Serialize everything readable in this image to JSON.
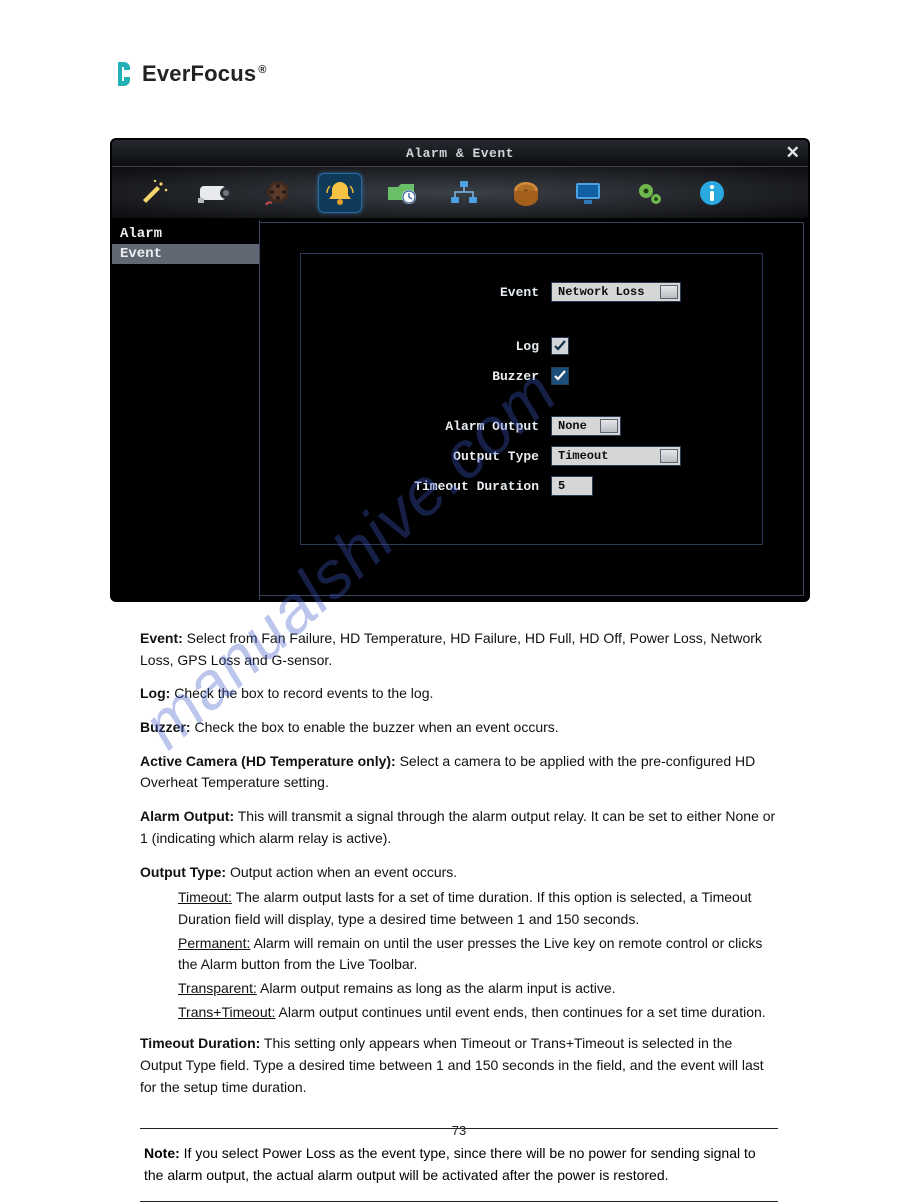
{
  "brand": {
    "ever": "Ever",
    "focus": "Focus",
    "registered": "®"
  },
  "screenshot": {
    "window_title": "Alarm & Event",
    "close_glyph": "✕",
    "toolbar_icons": [
      "wand-icon",
      "camera-icon",
      "reel-icon",
      "bell-icon",
      "folder-clock-icon",
      "network-icon",
      "disk-icon",
      "monitor-icon",
      "gear-icon",
      "info-icon"
    ],
    "toolbar_selected_index": 3,
    "side_items": [
      "Alarm",
      "Event"
    ],
    "side_active_index": 1,
    "fields": {
      "event_label": "Event",
      "event_value": "Network Loss",
      "log_label": "Log",
      "log_checked": true,
      "buzzer_label": "Buzzer",
      "buzzer_checked": true,
      "alarm_output_label": "Alarm Output",
      "alarm_output_value": "None",
      "output_type_label": "Output Type",
      "output_type_value": "Timeout",
      "timeout_duration_label": "Timeout Duration",
      "timeout_duration_value": "5"
    }
  },
  "doc": {
    "p1_label": "Event:",
    "p1_text": " Select from Fan Failure, HD Temperature, HD Failure, HD Full, HD Off, Power Loss, Network Loss, GPS Loss and G-sensor.",
    "p2_label": "Log:",
    "p2_text": " Check the box to record events to the log.",
    "p3_label": "Buzzer:",
    "p3_text": " Check the box to enable the buzzer when an event occurs.",
    "p4_label": "Active Camera (HD Temperature only):",
    "p4_text": " Select a camera to be applied with the pre-configured HD Overheat Temperature setting.",
    "p5_label": "Alarm Output:",
    "p5_text": " This will transmit a signal through the alarm output relay. It can be set to either None or 1 (indicating which alarm relay is active).",
    "p6_label": "Output Type:",
    "p6_text": " Output action when an event occurs.",
    "p6_timeout_lead": "Timeout:",
    "p6_timeout_text": " The alarm output lasts for a set of time duration. If this option is selected, a Timeout Duration field will display, type a desired time between 1 and 150 seconds.",
    "p6_perm_lead": "Permanent:",
    "p6_perm_text": " Alarm will remain on until the user presses the Live key on remote control or clicks the Alarm button from the Live Toolbar.",
    "p6_trans_lead": "Transparent:",
    "p6_trans_text": " Alarm output remains as long as the alarm input is active.",
    "p6_tt_lead": "Trans+Timeout:",
    "p6_tt_text": " Alarm output continues until event ends, then continues for a set time duration.",
    "p7_label": "Timeout Duration:",
    "p7_text": " This setting only appears when Timeout or Trans+Timeout is selected in the Output Type field. Type a desired time between 1 and 150 seconds in the field, and the event will last for the setup time duration.",
    "note_label": "Note:",
    "note_text": " If you select Power Loss as the event type, since there will be no power for sending signal to the alarm output, the actual alarm output will be activated after the power is restored.",
    "page_number": "73"
  },
  "watermark_text": "manualshive.com"
}
